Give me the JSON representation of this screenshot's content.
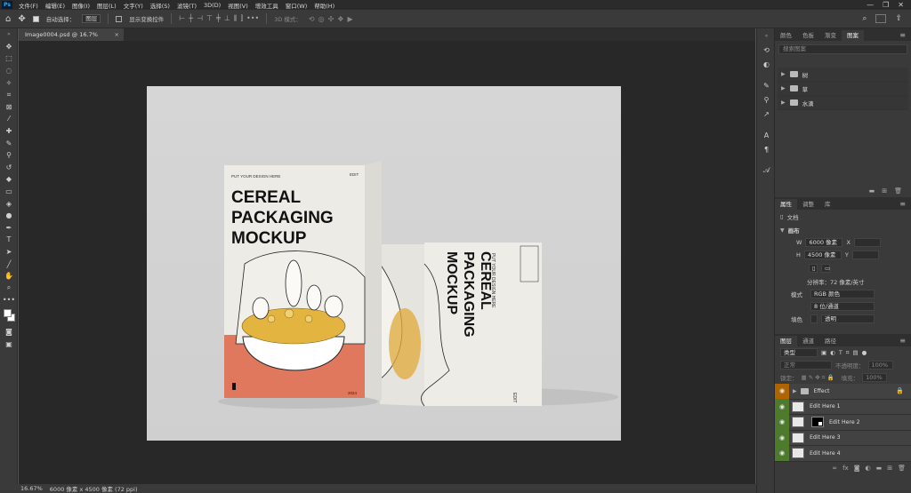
{
  "menubar": {
    "logo": "Ps",
    "items": [
      "文件(F)",
      "编辑(E)",
      "图像(I)",
      "图层(L)",
      "文字(Y)",
      "选择(S)",
      "滤镜(T)",
      "3D(D)",
      "视图(V)",
      "增效工具",
      "窗口(W)",
      "帮助(H)"
    ],
    "controls": [
      "—",
      "❐",
      "✕"
    ]
  },
  "options": {
    "auto_select_label": "自动选择：",
    "auto_select_value": "图层",
    "transform_label": "显示变换控件",
    "mode_3d_label": "3D 模式："
  },
  "document": {
    "tab_title": "Image0004.psd @ 16.7%(RGB/8#)",
    "close": "×"
  },
  "canvas_text": {
    "box1_top": "PUT YOUR DESIGN HERE",
    "box1_edit": "EDIT",
    "box1_l1": "CEREAL",
    "box1_l2": "PACKAGING",
    "box1_l3": "MOCKUP",
    "box1_num": "2024",
    "box2_top": "PUT YOUR DESIGN HERE",
    "box2_l1": "CEREAL",
    "box2_l2": "PACKAGING",
    "box2_l3": "MOCKUP",
    "box2_edit": "EDIT"
  },
  "status": {
    "zoom": "16.67%",
    "size": "6000 像素 x 4500 像素 (72 ppi)"
  },
  "libraries_panel": {
    "tabs": [
      "颜色",
      "色板",
      "渐变",
      "图案"
    ],
    "active_tab": "图案",
    "search_placeholder": "搜索图案",
    "folders": [
      "树",
      "草",
      "水滴"
    ]
  },
  "properties_panel": {
    "tabs": [
      "属性",
      "调整",
      "库"
    ],
    "doc_label": "文档",
    "canvas_label": "画布",
    "w_label": "W",
    "w_value": "6000 像素",
    "h_label": "H",
    "h_value": "4500 像素",
    "x_label": "X",
    "y_label": "Y",
    "resolution": "分辨率：72 像素/英寸",
    "mode_label": "模式",
    "mode_value": "RGB 颜色",
    "depth_value": "8 位/通道",
    "fill_label": "填色",
    "fill_value": "透明"
  },
  "layers_panel": {
    "tabs": [
      "图层",
      "通道",
      "路径"
    ],
    "kind_label": "类型",
    "blend_mode": "正常",
    "opacity_label": "不透明度：",
    "opacity_value": "100%",
    "lock_label": "锁定：",
    "fill_label": "填充：",
    "fill_value": "100%",
    "layers": [
      {
        "name": "Effect",
        "type": "group"
      },
      {
        "name": "Edit Here 1",
        "type": "smart"
      },
      {
        "name": "Edit Here 2",
        "type": "masked"
      },
      {
        "name": "Edit Here 3",
        "type": "smart"
      },
      {
        "name": "Edit Here 4",
        "type": "smart"
      }
    ]
  }
}
